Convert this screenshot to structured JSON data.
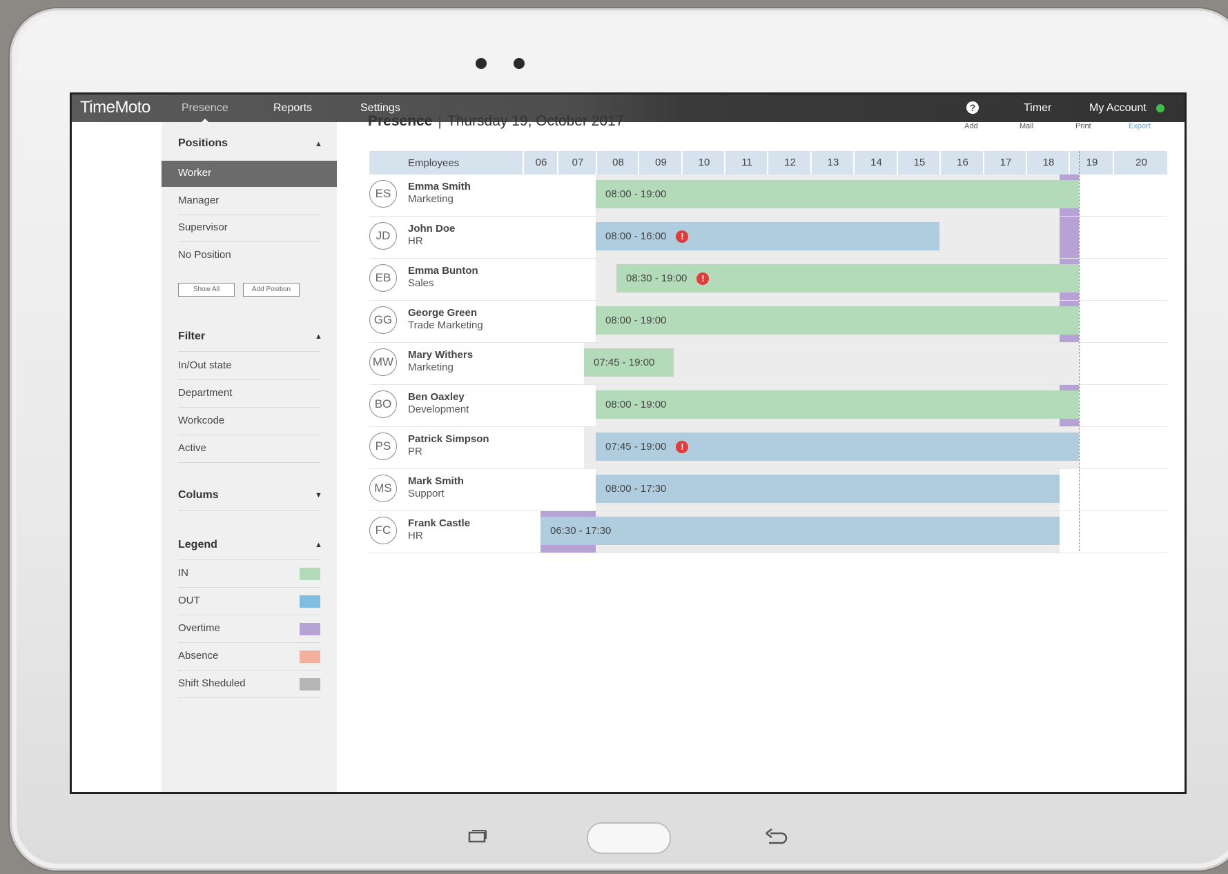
{
  "app": {
    "logo": "TimeMoto",
    "nav": [
      "Presence",
      "Reports",
      "Settings"
    ],
    "help": "?",
    "timer": "Timer",
    "account": "My Account",
    "account_status_color": "#3cc14a"
  },
  "sidebar": {
    "positions": {
      "title": "Positions",
      "items": [
        "Worker",
        "Manager",
        "Supervisor",
        "No Position"
      ],
      "selected": "Worker",
      "show_all": "Show All",
      "add_position": "Add Position"
    },
    "filter": {
      "title": "Filter",
      "items": [
        "In/Out state",
        "Department",
        "Workcode",
        "Active"
      ]
    },
    "columns": {
      "title": "Colums"
    },
    "legend": {
      "title": "Legend",
      "items": [
        {
          "label": "IN",
          "color": "#b3dbb9"
        },
        {
          "label": "OUT",
          "color": "#7fbde2"
        },
        {
          "label": "Overtime",
          "color": "#b6a2d4"
        },
        {
          "label": "Absence",
          "color": "#f4b09c"
        },
        {
          "label": "Shift Sheduled",
          "color": "#b5b5b5"
        }
      ]
    }
  },
  "main": {
    "title": "Presence",
    "separator": "|",
    "date": "Thursday 19, October 2017",
    "actions": [
      "Add",
      "Mail",
      "Print",
      "Export"
    ],
    "header_employees": "Employees",
    "hours": [
      "06",
      "07",
      "08",
      "09",
      "10",
      "11",
      "12",
      "13",
      "14",
      "15",
      "16",
      "17",
      "18",
      "19",
      "20"
    ],
    "employees": [
      {
        "initials": "ES",
        "name": "Emma Smith",
        "dept": "Marketing",
        "time": "08:00 - 19:00",
        "state": "in",
        "warning": false
      },
      {
        "initials": "JD",
        "name": "John Doe",
        "dept": "HR",
        "time": "08:00 - 16:00",
        "state": "out",
        "warning": true
      },
      {
        "initials": "EB",
        "name": "Emma Bunton",
        "dept": "Sales",
        "time": "08:30 - 19:00",
        "state": "in",
        "warning": true
      },
      {
        "initials": "GG",
        "name": "George Green",
        "dept": "Trade Marketing",
        "time": "08:00 - 19:00",
        "state": "in",
        "warning": false
      },
      {
        "initials": "MW",
        "name": "Mary Withers",
        "dept": "Marketing",
        "time": "07:45 - 19:00",
        "state": "in",
        "warning": false
      },
      {
        "initials": "BO",
        "name": "Ben Oaxley",
        "dept": "Development",
        "time": "08:00 - 19:00",
        "state": "in",
        "warning": false
      },
      {
        "initials": "PS",
        "name": "Patrick Simpson",
        "dept": "PR",
        "time": "07:45 - 19:00",
        "state": "out",
        "warning": true
      },
      {
        "initials": "MS",
        "name": "Mark Smith",
        "dept": "Support",
        "time": "08:00 - 17:30",
        "state": "out",
        "warning": false
      },
      {
        "initials": "FC",
        "name": "Frank Castle",
        "dept": "HR",
        "time": "06:30 - 17:30",
        "state": "out",
        "warning": false
      }
    ]
  }
}
